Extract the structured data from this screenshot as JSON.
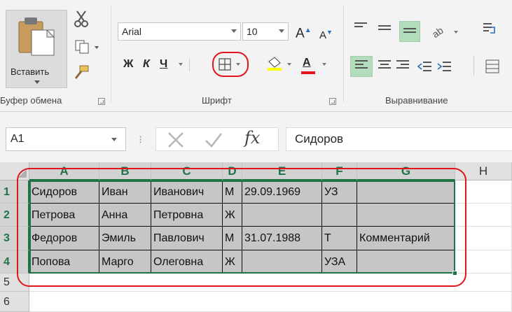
{
  "ribbon": {
    "clipboard": {
      "paste_label": "Вставить",
      "group_label": "Буфер обмена"
    },
    "font": {
      "font_name": "Arial",
      "font_size": "10",
      "bold": "Ж",
      "italic": "К",
      "underline": "Ч",
      "grow_font": "A",
      "shrink_font": "A",
      "font_color_letter": "A",
      "group_label": "Шрифт"
    },
    "alignment": {
      "group_label": "Выравнивание"
    },
    "colors": {
      "accent_green": "#217346",
      "highlight_red": "#e0161c",
      "fill_yellow": "#ffff00",
      "font_red": "#e0161c"
    }
  },
  "formula_bar": {
    "name_box": "A1",
    "fx": "fx",
    "formula_value": "Сидоров"
  },
  "grid": {
    "columns": [
      "A",
      "B",
      "C",
      "D",
      "E",
      "F",
      "G",
      "H"
    ],
    "rows": [
      "1",
      "2",
      "3",
      "4",
      "5",
      "6"
    ],
    "data": [
      [
        "Сидоров",
        "Иван",
        "Иванович",
        "М",
        "29.09.1969",
        "УЗ",
        ""
      ],
      [
        "Петрова",
        "Анна",
        "Петровна",
        "Ж",
        "",
        "",
        ""
      ],
      [
        "Федоров",
        "Эмиль",
        "Павлович",
        "М",
        "31.07.1988",
        "Т",
        "Комментарий"
      ],
      [
        "Попова",
        "Марго",
        "Олеговна",
        "Ж",
        "",
        "УЗА",
        ""
      ]
    ]
  }
}
